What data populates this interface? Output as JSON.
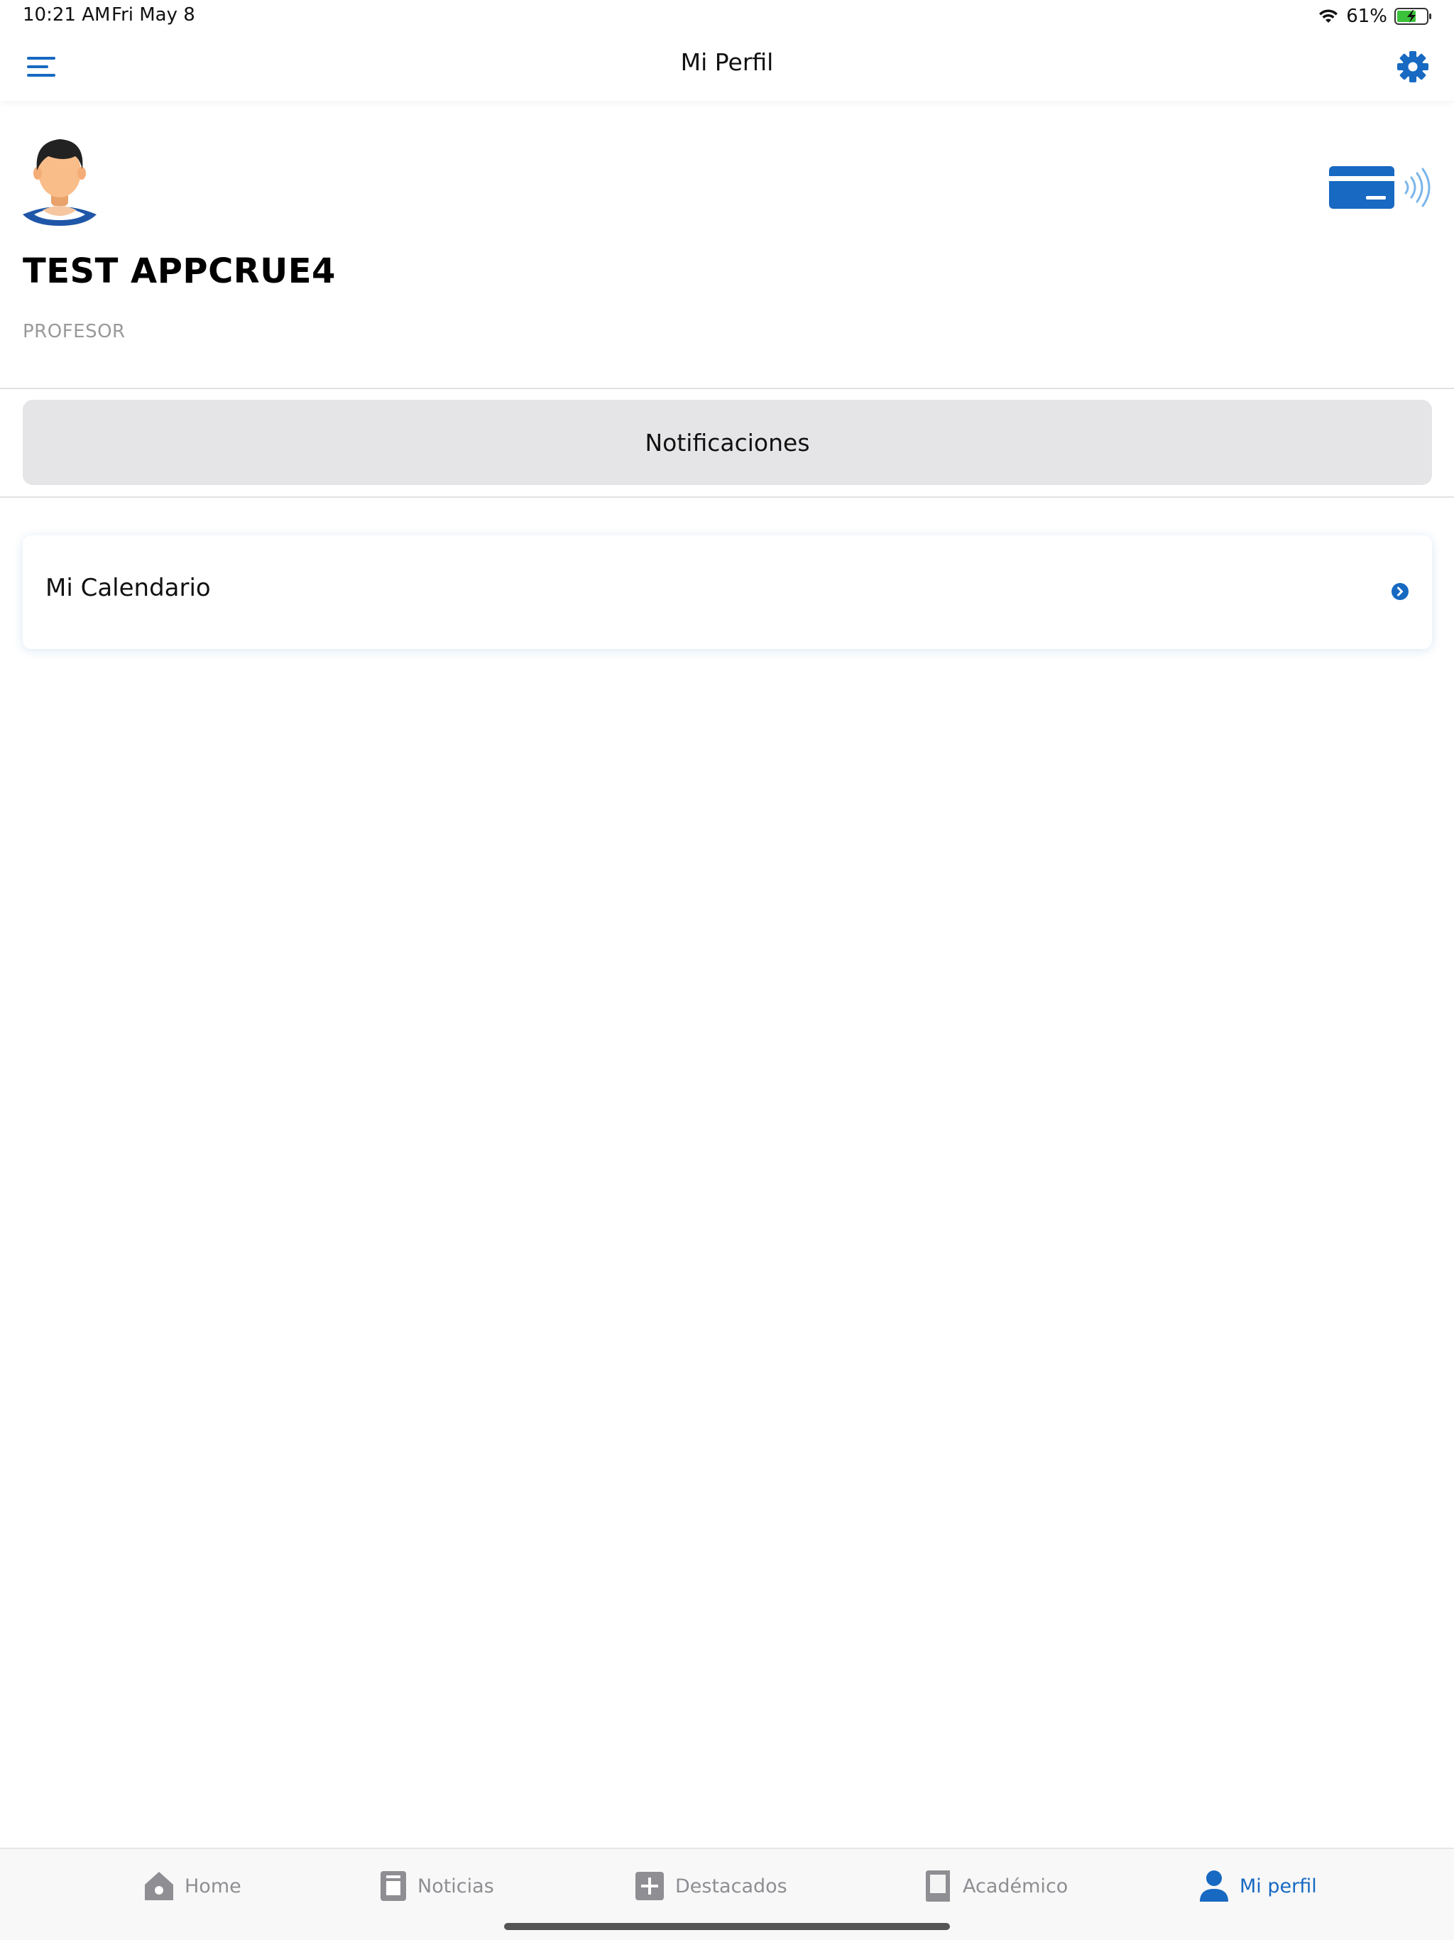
{
  "status_bar": {
    "time": "10:21 AM",
    "date": "Fri May 8",
    "battery": "61%"
  },
  "nav": {
    "title": "Mi Perfil",
    "menu_icon": "hamburger-menu-icon",
    "settings_icon": "gear-icon"
  },
  "profile": {
    "name": "TEST APPCRUE4",
    "role": "PROFESOR",
    "card_icon": "nfc-card-icon"
  },
  "notifications": {
    "label": "Notificaciones"
  },
  "calendar": {
    "label": "Mi Calendario",
    "chevron_icon": "chevron-right-circle-icon"
  },
  "tabs": [
    {
      "label": "Home",
      "icon": "home-icon",
      "active": false
    },
    {
      "label": "Noticias",
      "icon": "news-icon",
      "active": false
    },
    {
      "label": "Destacados",
      "icon": "plus-square-icon",
      "active": false
    },
    {
      "label": "Académico",
      "icon": "book-icon",
      "active": false
    },
    {
      "label": "Mi perfil",
      "icon": "user-icon",
      "active": true
    }
  ],
  "colors": {
    "accent": "#1769c2",
    "tab_inactive": "#8e8e93",
    "button_bg": "#e5e5e7",
    "battery_fill": "#3cc13b"
  }
}
